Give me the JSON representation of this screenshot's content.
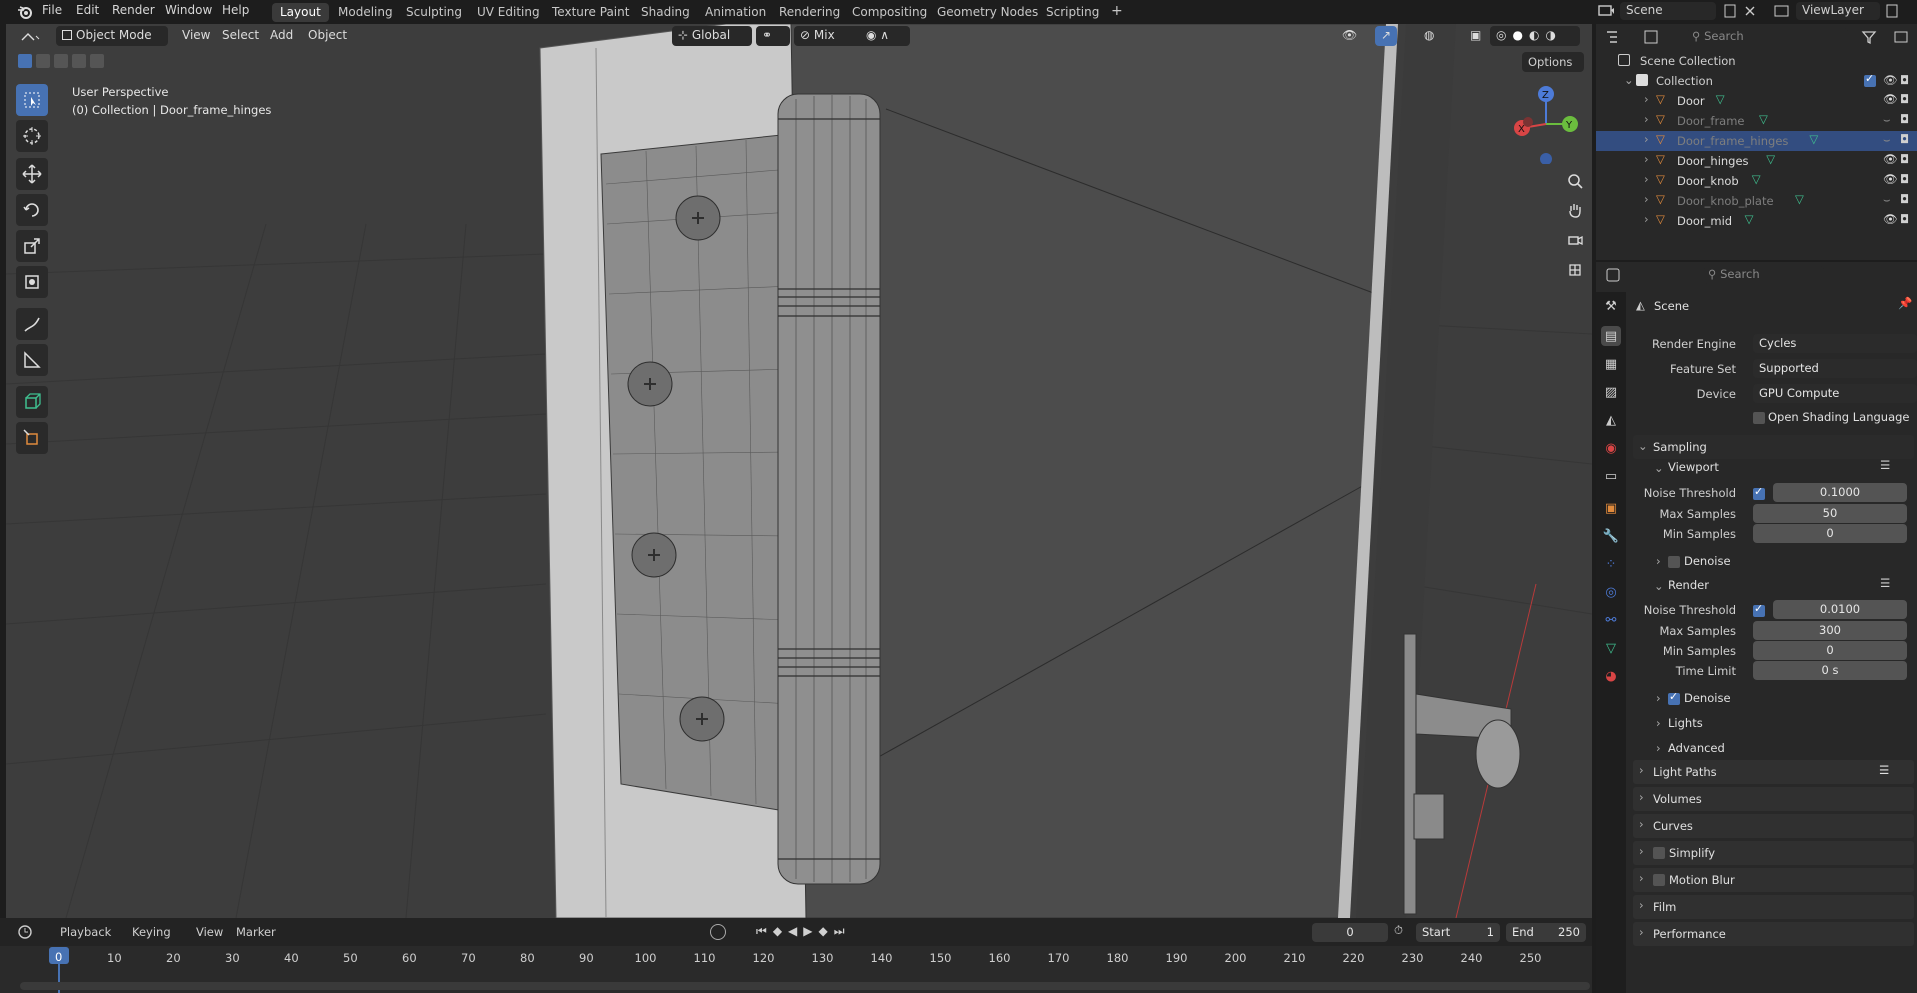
{
  "topbar": {
    "menus": [
      "File",
      "Edit",
      "Render",
      "Window",
      "Help"
    ],
    "workspaces": [
      "Layout",
      "Modeling",
      "Sculpting",
      "UV Editing",
      "Texture Paint",
      "Shading",
      "Animation",
      "Rendering",
      "Compositing",
      "Geometry Nodes",
      "Scripting"
    ],
    "active_workspace": "Layout",
    "add_tab": "+",
    "scene_name": "Scene",
    "view_layer": "ViewLayer"
  },
  "viewport_header": {
    "mode": "Object Mode",
    "menus": [
      "View",
      "Select",
      "Add",
      "Object"
    ],
    "orientation": "Global",
    "snap": "Mix",
    "options": "Options"
  },
  "viewport": {
    "perspective": "User Perspective",
    "collection_info": "(0) Collection | Door_frame_hinges",
    "gizmo": {
      "z": "Z",
      "y": "Y",
      "x": "X"
    }
  },
  "outliner": {
    "search_placeholder": "Search",
    "scene_collection": "Scene Collection",
    "collection": "Collection",
    "items": [
      {
        "name": "Door",
        "dim": false,
        "selected": false,
        "visible": true
      },
      {
        "name": "Door_frame",
        "dim": true,
        "selected": false,
        "visible": false
      },
      {
        "name": "Door_frame_hinges",
        "dim": true,
        "selected": true,
        "visible": false
      },
      {
        "name": "Door_hinges",
        "dim": false,
        "selected": false,
        "visible": true
      },
      {
        "name": "Door_knob",
        "dim": false,
        "selected": false,
        "visible": true
      },
      {
        "name": "Door_knob_plate",
        "dim": true,
        "selected": false,
        "visible": false
      },
      {
        "name": "Door_mid",
        "dim": false,
        "selected": false,
        "visible": true
      }
    ]
  },
  "properties": {
    "search_placeholder": "Search",
    "context": "Scene",
    "render_engine_label": "Render Engine",
    "render_engine": "Cycles",
    "feature_set_label": "Feature Set",
    "feature_set": "Supported",
    "device_label": "Device",
    "device": "GPU Compute",
    "osl_label": "Open Shading Language",
    "sampling": "Sampling",
    "viewport": "Viewport",
    "noise_threshold_label": "Noise Threshold",
    "viewport_noise_threshold": "0.1000",
    "max_samples_label": "Max Samples",
    "viewport_max_samples": "50",
    "min_samples_label": "Min Samples",
    "viewport_min_samples": "0",
    "denoise_label": "Denoise",
    "render": "Render",
    "render_noise_threshold": "0.0100",
    "render_max_samples": "300",
    "render_min_samples": "0",
    "time_limit_label": "Time Limit",
    "time_limit": "0 s",
    "lights": "Lights",
    "advanced": "Advanced",
    "sections": [
      "Light Paths",
      "Volumes",
      "Curves",
      "Simplify",
      "Motion Blur",
      "Film",
      "Performance"
    ]
  },
  "timeline": {
    "menus": [
      "Playback",
      "Keying",
      "View",
      "Marker"
    ],
    "current_frame": "0",
    "start_label": "Start",
    "start": "1",
    "end_label": "End",
    "end": "250",
    "ruler": [
      "0",
      "10",
      "20",
      "30",
      "40",
      "50",
      "60",
      "70",
      "80",
      "90",
      "100",
      "110",
      "120",
      "130",
      "140",
      "150",
      "160",
      "170",
      "180",
      "190",
      "200",
      "210",
      "220",
      "230",
      "240",
      "250"
    ]
  },
  "colors": {
    "accent": "#4772b3",
    "selection": "#334d80",
    "object_icon": "#e08a3c",
    "mesh_icon": "#3fbf8f"
  }
}
